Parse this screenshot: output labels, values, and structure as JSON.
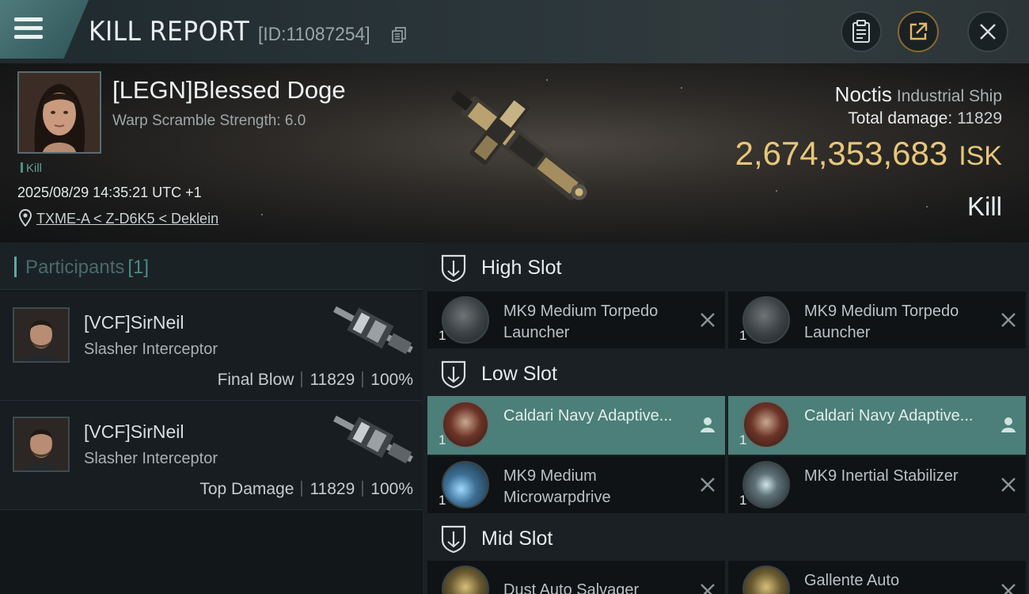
{
  "header": {
    "title": "KILL REPORT",
    "report_id": "[ID:11087254]"
  },
  "victim": {
    "name": "[LEGN]Blessed Doge",
    "warp_scramble": "Warp Scramble Strength: 6.0",
    "tag": "Kill",
    "datetime": "2025/08/29 14:35:21 UTC +1",
    "location": "TXME-A < Z-D6K5 < Deklein"
  },
  "ship": {
    "name": "Noctis",
    "class": "Industrial Ship",
    "damage_label": "Total damage:",
    "damage_value": "11829",
    "isk_value": "2,674,353,683",
    "isk_unit": "ISK",
    "result": "Kill"
  },
  "participants": {
    "label": "Participants",
    "count": "[1]",
    "rows": [
      {
        "name": "[VCF]SirNeil",
        "ship": "Slasher Interceptor",
        "role": "Final Blow",
        "damage": "11829",
        "percent": "100%"
      },
      {
        "name": "[VCF]SirNeil",
        "ship": "Slasher Interceptor",
        "role": "Top Damage",
        "damage": "11829",
        "percent": "100%"
      }
    ]
  },
  "fitting": {
    "high_slot": {
      "label": "High Slot",
      "modules": [
        {
          "qty": "1",
          "name": "MK9 Medium Torpedo Launcher",
          "icon": "torpedo-launcher-icon",
          "state": "destroyed"
        },
        {
          "qty": "1",
          "name": "MK9 Medium Torpedo Launcher",
          "icon": "torpedo-launcher-icon",
          "state": "destroyed"
        }
      ]
    },
    "low_slot": {
      "label": "Low Slot",
      "modules": [
        {
          "qty": "1",
          "name": "Caldari Navy Adaptive...",
          "icon": "adaptive-hardener-icon",
          "state": "dropped"
        },
        {
          "qty": "1",
          "name": "Caldari Navy Adaptive...",
          "icon": "adaptive-hardener-icon",
          "state": "dropped"
        },
        {
          "qty": "1",
          "name": "MK9 Medium Microwarpdrive",
          "icon": "microwarpdrive-icon",
          "state": "destroyed"
        },
        {
          "qty": "1",
          "name": "MK9 Inertial Stabilizer",
          "icon": "inertial-stabilizer-icon",
          "state": "destroyed"
        }
      ]
    },
    "mid_slot": {
      "label": "Mid Slot",
      "modules": [
        {
          "qty": "1",
          "name": "Dust Auto Salvager",
          "icon": "salvager-icon",
          "state": "destroyed"
        },
        {
          "qty": "1",
          "name": "Gallente Auto",
          "icon": "salvager-icon",
          "state": "destroyed"
        }
      ]
    }
  },
  "colors": {
    "accent_teal": "#4c7f79",
    "isk_gold": "#e8c77a"
  }
}
